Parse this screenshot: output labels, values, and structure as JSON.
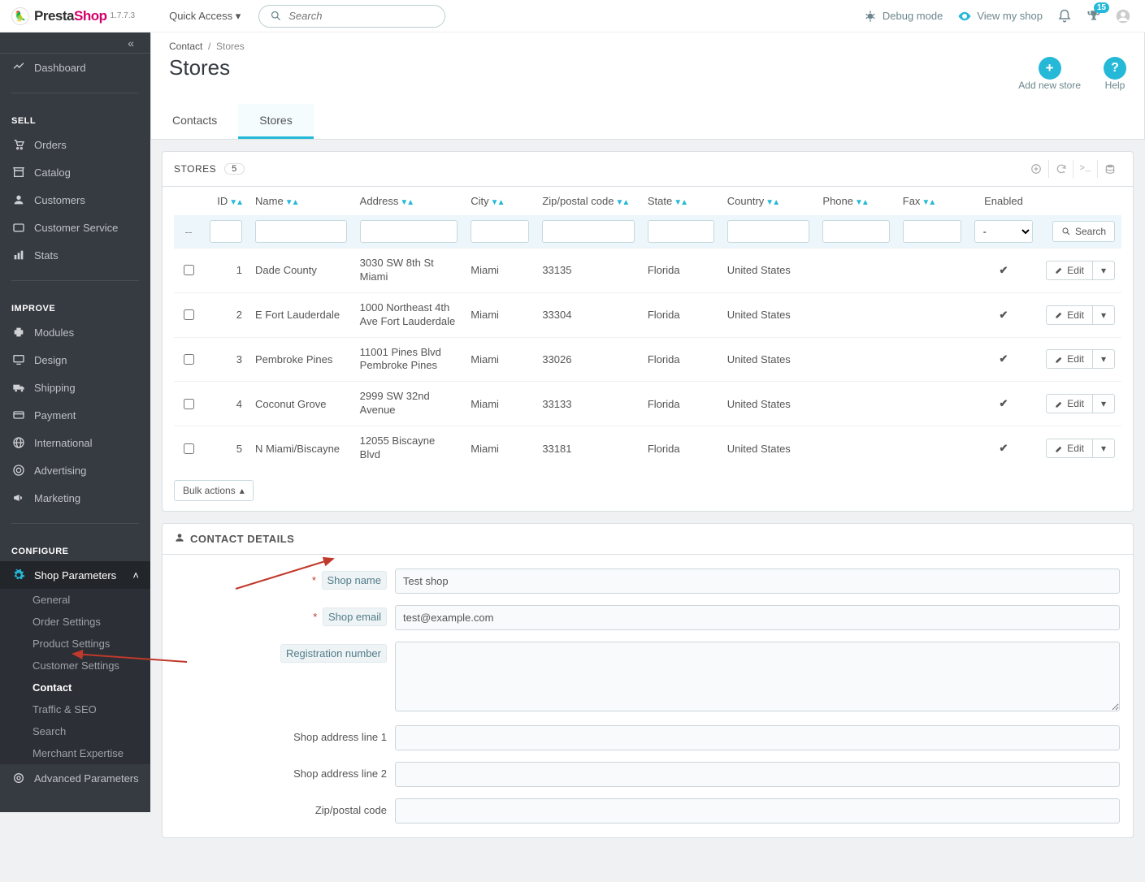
{
  "app": {
    "brand_a": "Presta",
    "brand_b": "Shop",
    "version": "1.7.7.3"
  },
  "topbar": {
    "quick": "Quick Access",
    "search_placeholder": "Search",
    "debug": "Debug mode",
    "view_shop": "View my shop",
    "badge": "15"
  },
  "sidebar": {
    "dashboard": "Dashboard",
    "sell": "SELL",
    "orders": "Orders",
    "catalog": "Catalog",
    "customers": "Customers",
    "customer_service": "Customer Service",
    "stats": "Stats",
    "improve": "IMPROVE",
    "modules": "Modules",
    "design": "Design",
    "shipping": "Shipping",
    "payment": "Payment",
    "international": "International",
    "advertising": "Advertising",
    "marketing": "Marketing",
    "configure": "CONFIGURE",
    "shop_params": "Shop Parameters",
    "sub": {
      "general": "General",
      "order_settings": "Order Settings",
      "product_settings": "Product Settings",
      "customer_settings": "Customer Settings",
      "contact": "Contact",
      "traffic": "Traffic & SEO",
      "search": "Search",
      "merchant": "Merchant Expertise"
    },
    "advanced": "Advanced Parameters"
  },
  "breadcrumb": {
    "a": "Contact",
    "b": "Stores"
  },
  "page": {
    "title": "Stores",
    "add_new": "Add new store",
    "help": "Help",
    "tab_contacts": "Contacts",
    "tab_stores": "Stores"
  },
  "table": {
    "title": "STORES",
    "count": "5",
    "search_btn": "Search",
    "edit": "Edit",
    "bulk": "Bulk actions",
    "sep": "--",
    "cols": {
      "id": "ID",
      "name": "Name",
      "address": "Address",
      "city": "City",
      "zip": "Zip/postal code",
      "state": "State",
      "country": "Country",
      "phone": "Phone",
      "fax": "Fax",
      "enabled": "Enabled"
    },
    "rows": [
      {
        "id": "1",
        "name": "Dade County",
        "address": "3030 SW 8th St Miami",
        "city": "Miami",
        "zip": "33135",
        "state": "Florida",
        "country": "United States"
      },
      {
        "id": "2",
        "name": "E Fort Lauderdale",
        "address": "1000 Northeast 4th Ave Fort Lauderdale",
        "city": "Miami",
        "zip": "33304",
        "state": "Florida",
        "country": "United States"
      },
      {
        "id": "3",
        "name": "Pembroke Pines",
        "address": "11001 Pines Blvd Pembroke Pines",
        "city": "Miami",
        "zip": "33026",
        "state": "Florida",
        "country": "United States"
      },
      {
        "id": "4",
        "name": "Coconut Grove",
        "address": "2999 SW 32nd Avenue",
        "city": "Miami",
        "zip": "33133",
        "state": "Florida",
        "country": "United States"
      },
      {
        "id": "5",
        "name": "N Miami/Biscayne",
        "address": "12055 Biscayne Blvd",
        "city": "Miami",
        "zip": "33181",
        "state": "Florida",
        "country": "United States"
      }
    ]
  },
  "details": {
    "title": "CONTACT DETAILS",
    "shop_name_lbl": "Shop name",
    "shop_name_val": "Test shop",
    "shop_email_lbl": "Shop email",
    "shop_email_val": "test@example.com",
    "reg_lbl": "Registration number",
    "addr1_lbl": "Shop address line 1",
    "addr2_lbl": "Shop address line 2",
    "zip_lbl": "Zip/postal code"
  }
}
